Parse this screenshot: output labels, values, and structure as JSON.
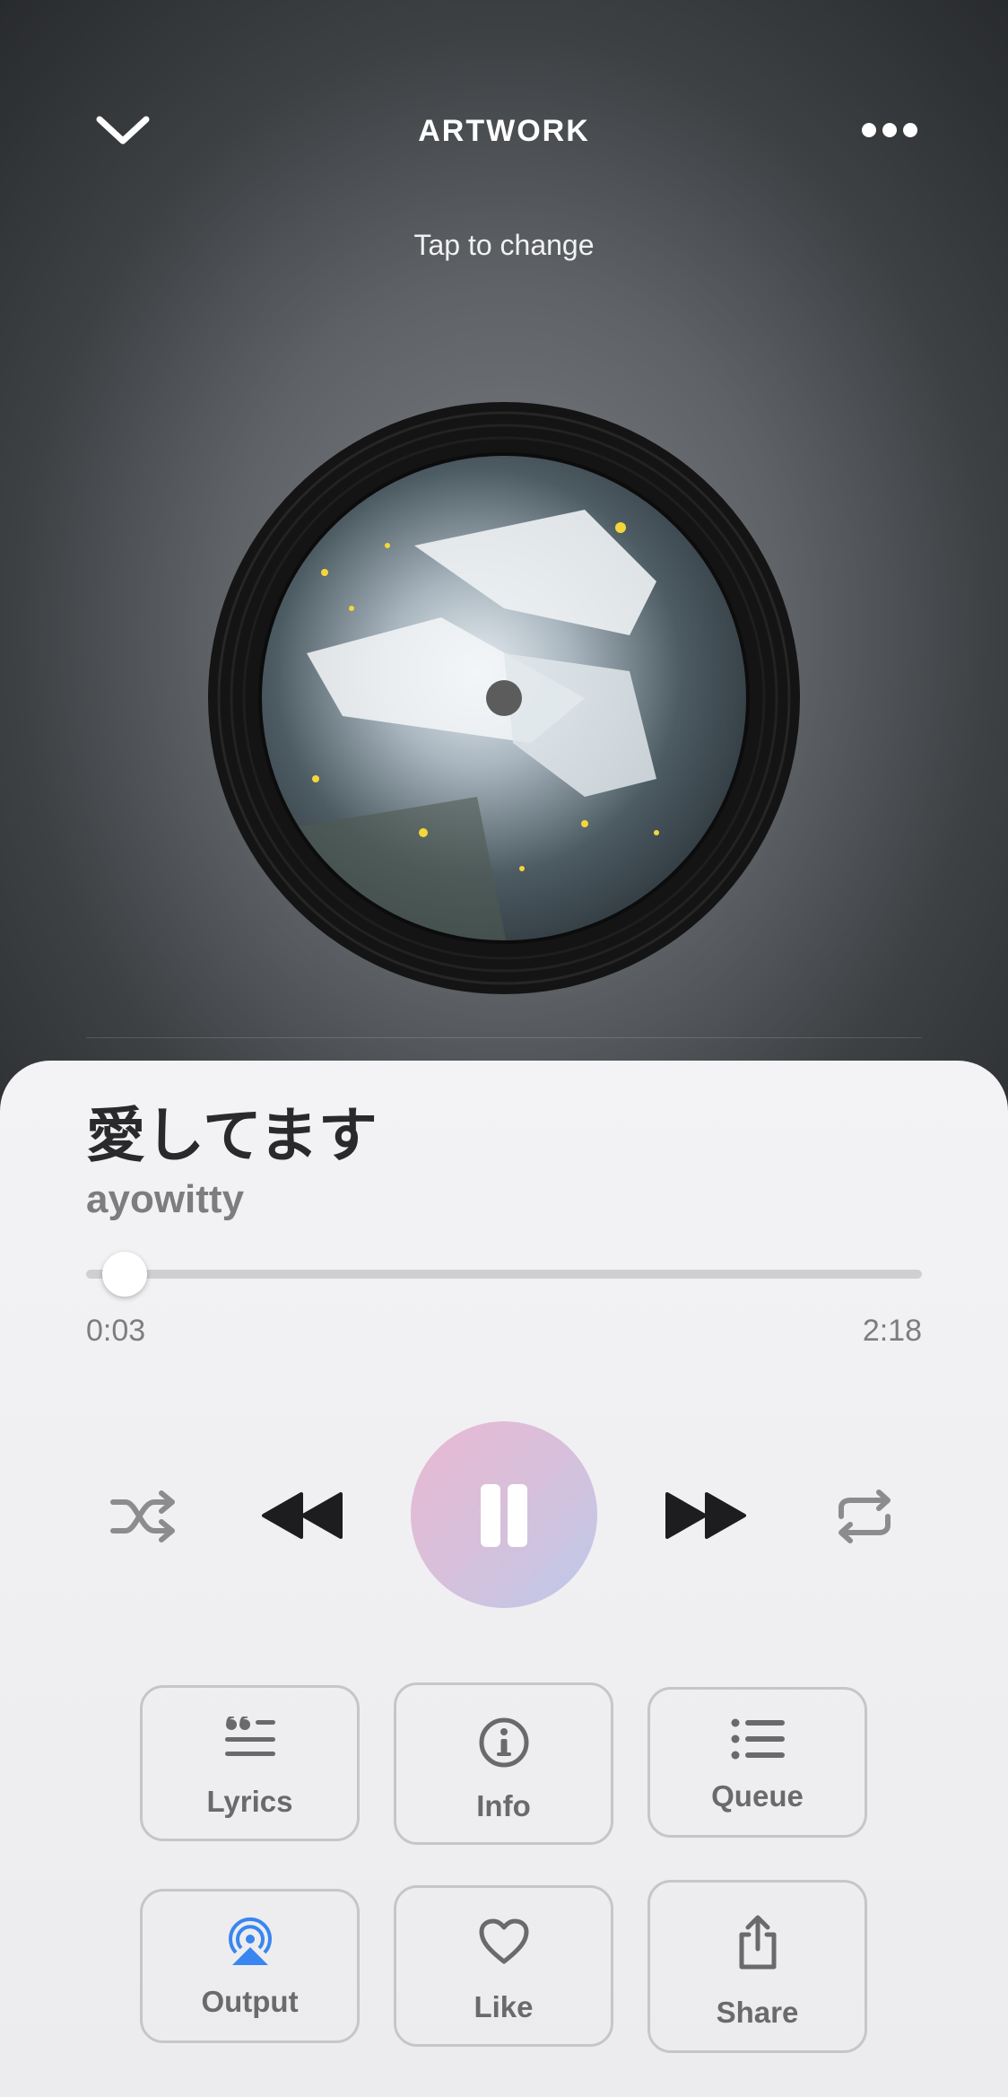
{
  "header": {
    "title": "ARTWORK",
    "subtitle": "Tap to change"
  },
  "track": {
    "title": "愛してます",
    "artist": "ayowitty",
    "elapsed": "0:03",
    "duration": "2:18",
    "progress": 0.02
  },
  "actions": [
    {
      "label": "Lyrics",
      "icon": "quote-lines-icon"
    },
    {
      "label": "Info",
      "icon": "info-icon"
    },
    {
      "label": "Queue",
      "icon": "list-icon"
    },
    {
      "label": "Output",
      "icon": "airplay-icon"
    },
    {
      "label": "Like",
      "icon": "heart-icon"
    },
    {
      "label": "Share",
      "icon": "share-icon"
    }
  ],
  "colors": {
    "accent_output": "#3a86f0",
    "text_primary": "#2a2a2c",
    "text_secondary": "#7d7d80"
  }
}
